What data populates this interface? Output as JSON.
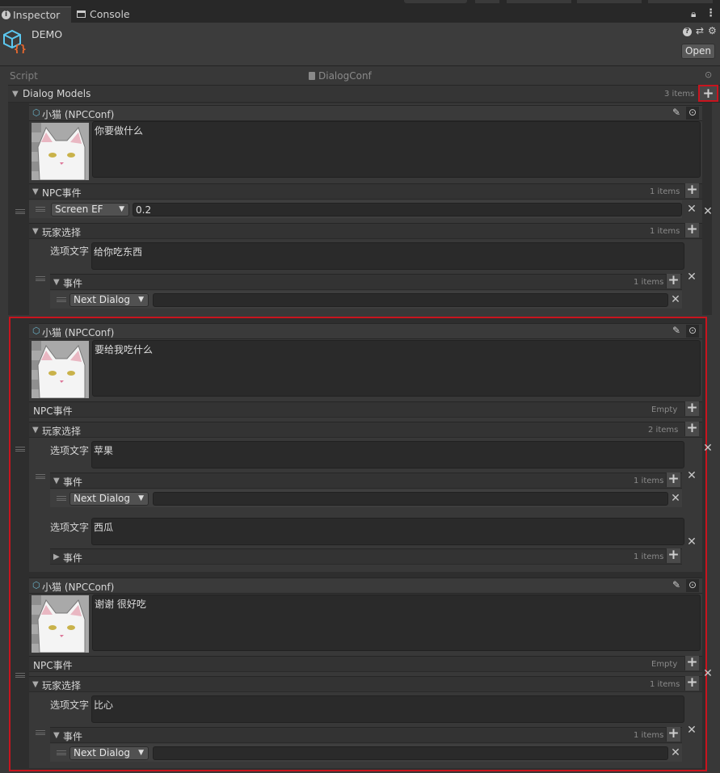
{
  "tabs": {
    "inspector": "Inspector",
    "console": "Console"
  },
  "header": {
    "object_name": "DEMO",
    "open_button": "Open"
  },
  "script_row": {
    "label": "Script",
    "value": "DialogConf"
  },
  "dialog_models": {
    "label": "Dialog Models",
    "count": "3 items"
  },
  "npc_header_text": "小猫 (NPCConf)",
  "labels": {
    "npc_events": "NPC事件",
    "player_choice": "玩家选择",
    "option_text": "选项文字",
    "events": "事件",
    "empty": "Empty",
    "one_item": "1 items",
    "two_items": "2 items"
  },
  "dropdowns": {
    "screen_ef": "Screen EF",
    "next_dialog": "Next Dialog"
  },
  "models": [
    {
      "dialog_text": "你要做什么",
      "npc_event_value": "0.2",
      "options": [
        {
          "text": "给你吃东西"
        }
      ]
    },
    {
      "dialog_text": "要给我吃什么",
      "options": [
        {
          "text": "苹果"
        },
        {
          "text": "西瓜"
        }
      ]
    },
    {
      "dialog_text": "谢谢 很好吃",
      "options": [
        {
          "text": "比心"
        }
      ]
    }
  ],
  "colors": {
    "selection_outline": "#c8141e",
    "background": "#383838",
    "field": "#2a2a2a"
  }
}
